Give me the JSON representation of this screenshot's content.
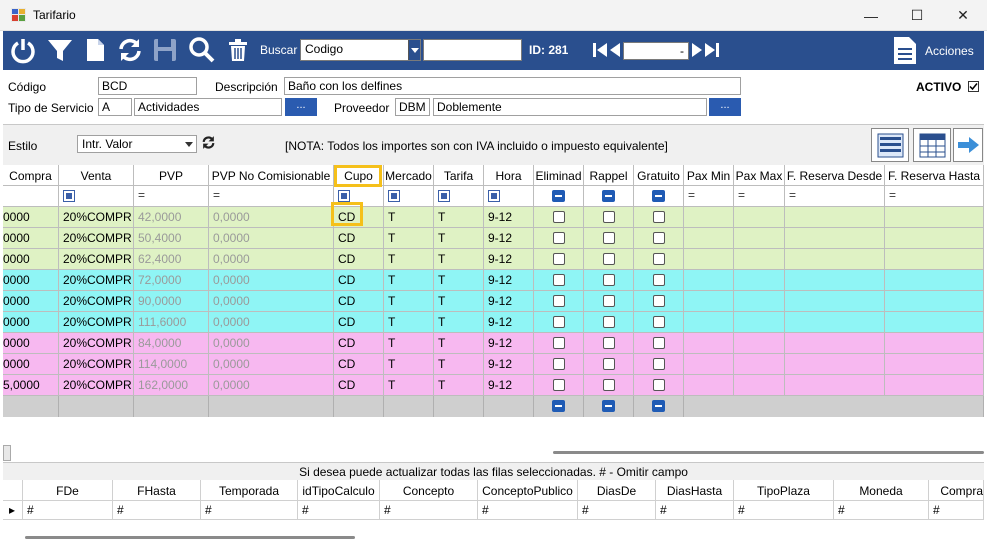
{
  "window": {
    "title": "Tarifario",
    "minimize": "—",
    "maximize": "☐",
    "close": "✕"
  },
  "toolbar": {
    "search_label": "Buscar",
    "search_field": "Codigo",
    "search_value": "",
    "id_label": "ID: 281",
    "nav_value": "-",
    "actions_label": "Acciones",
    "icons": [
      "power-icon",
      "filter-icon",
      "new-document-icon",
      "refresh-icon",
      "save-icon",
      "search-icon",
      "delete-icon"
    ]
  },
  "form": {
    "codigo_label": "Código",
    "codigo_value": "BCD",
    "descripcion_label": "Descripción",
    "descripcion_value": "Baño con los delfines",
    "activo_label": "ACTIVO",
    "tipo_label": "Tipo de Servicio",
    "tipo_code": "A",
    "tipo_value": "Actividades",
    "proveedor_label": "Proveedor",
    "proveedor_code": "DBM",
    "proveedor_value": "Doblemente",
    "browse_label": "..."
  },
  "options": {
    "estilo_label": "Estilo",
    "estilo_value": "Intr. Valor",
    "note": "[NOTA: Todos los importes son con IVA incluido o impuesto equivalente]"
  },
  "grid": {
    "headers": [
      "Compra",
      "Venta",
      "PVP",
      "PVP No Comisionable",
      "Cupo",
      "Mercado",
      "Tarifa",
      "Hora",
      "Eliminad",
      "Rappel",
      "Gratuito",
      "Pax Min",
      "Pax Max",
      "F. Reserva Desde",
      "F. Reserva Hasta"
    ],
    "rows": [
      {
        "compra": "0000",
        "venta": "20%COMPR",
        "pvp": "42,0000",
        "pvpnc": "0,0000",
        "cupo": "CD",
        "mercado": "T",
        "tarifa": "T",
        "hora": "9-12",
        "color": "#dff2c4"
      },
      {
        "compra": "0000",
        "venta": "20%COMPR",
        "pvp": "50,4000",
        "pvpnc": "0,0000",
        "cupo": "CD",
        "mercado": "T",
        "tarifa": "T",
        "hora": "9-12",
        "color": "#dff2c4"
      },
      {
        "compra": "0000",
        "venta": "20%COMPR",
        "pvp": "62,4000",
        "pvpnc": "0,0000",
        "cupo": "CD",
        "mercado": "T",
        "tarifa": "T",
        "hora": "9-12",
        "color": "#dff2c4"
      },
      {
        "compra": "0000",
        "venta": "20%COMPR",
        "pvp": "72,0000",
        "pvpnc": "0,0000",
        "cupo": "CD",
        "mercado": "T",
        "tarifa": "T",
        "hora": "9-12",
        "color": "#8ff5f5"
      },
      {
        "compra": "0000",
        "venta": "20%COMPR",
        "pvp": "90,0000",
        "pvpnc": "0,0000",
        "cupo": "CD",
        "mercado": "T",
        "tarifa": "T",
        "hora": "9-12",
        "color": "#8ff5f5"
      },
      {
        "compra": "0000",
        "venta": "20%COMPR",
        "pvp": "111,6000",
        "pvpnc": "0,0000",
        "cupo": "CD",
        "mercado": "T",
        "tarifa": "T",
        "hora": "9-12",
        "color": "#8ff5f5"
      },
      {
        "compra": "0000",
        "venta": "20%COMPR",
        "pvp": "84,0000",
        "pvpnc": "0,0000",
        "cupo": "CD",
        "mercado": "T",
        "tarifa": "T",
        "hora": "9-12",
        "color": "#f7b8f0"
      },
      {
        "compra": "0000",
        "venta": "20%COMPR",
        "pvp": "114,0000",
        "pvpnc": "0,0000",
        "cupo": "CD",
        "mercado": "T",
        "tarifa": "T",
        "hora": "9-12",
        "color": "#f7b8f0"
      },
      {
        "compra": "5,0000",
        "venta": "20%COMPR",
        "pvp": "162,0000",
        "pvpnc": "0,0000",
        "cupo": "CD",
        "mercado": "T",
        "tarifa": "T",
        "hora": "9-12",
        "color": "#f7b8f0"
      }
    ]
  },
  "bottom": {
    "note": "Si desea puede actualizar todas las filas seleccionadas. # - Omitir campo",
    "headers": [
      "FDe",
      "FHasta",
      "Temporada",
      "idTipoCalculo",
      "Concepto",
      "ConceptoPublico",
      "DiasDe",
      "DiasHasta",
      "TipoPlaza",
      "Moneda",
      "Compra"
    ],
    "values": [
      "#",
      "#",
      "#",
      "#",
      "#",
      "#",
      "#",
      "#",
      "#",
      "#",
      "#"
    ]
  }
}
